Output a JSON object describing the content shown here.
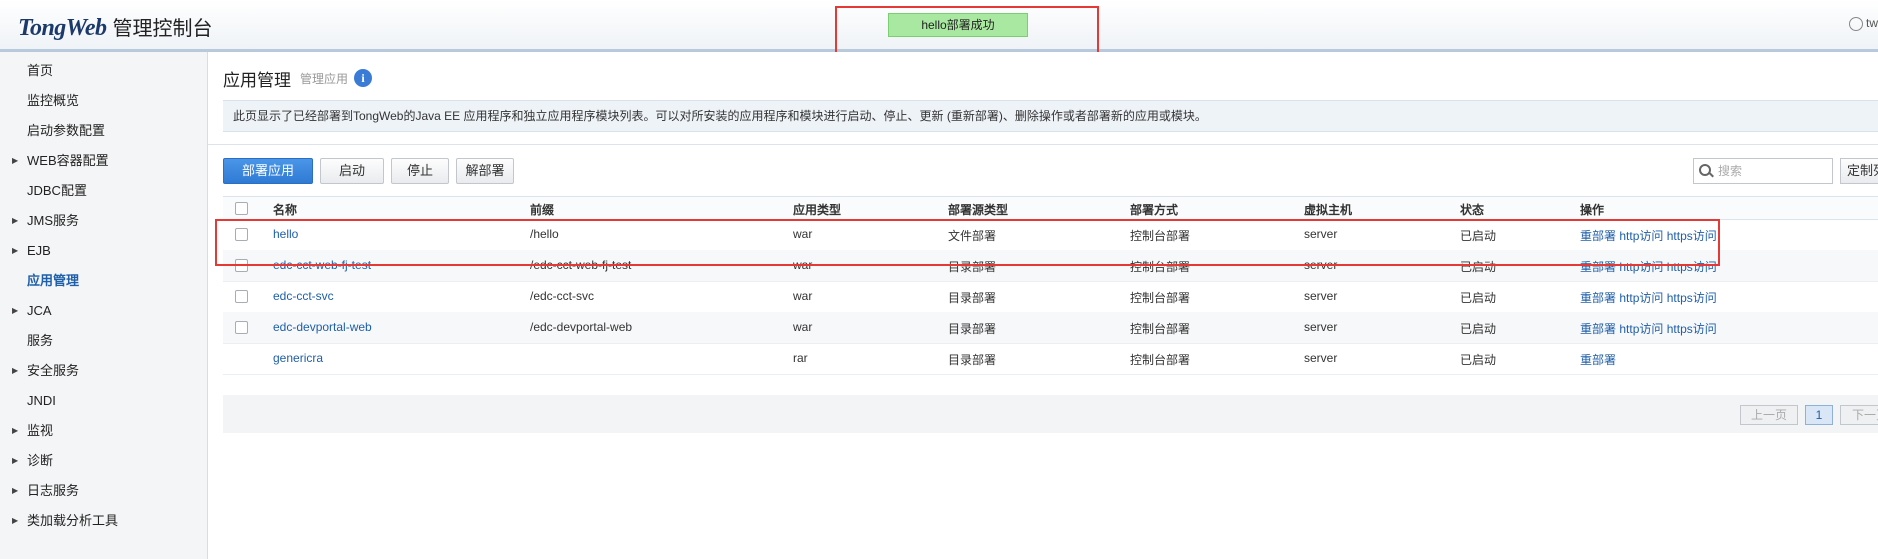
{
  "header": {
    "logo_brand": "TongWeb",
    "logo_subtitle": "管理控制台",
    "toast": "hello部署成功",
    "user": "tw"
  },
  "sidebar": {
    "items": [
      {
        "label": "首页",
        "has_arrow": false,
        "active": false
      },
      {
        "label": "监控概览",
        "has_arrow": false,
        "active": false
      },
      {
        "label": "启动参数配置",
        "has_arrow": false,
        "active": false
      },
      {
        "label": "WEB容器配置",
        "has_arrow": true,
        "active": false
      },
      {
        "label": "JDBC配置",
        "has_arrow": false,
        "active": false
      },
      {
        "label": "JMS服务",
        "has_arrow": true,
        "active": false
      },
      {
        "label": "EJB",
        "has_arrow": true,
        "active": false
      },
      {
        "label": "应用管理",
        "has_arrow": false,
        "active": true
      },
      {
        "label": "JCA",
        "has_arrow": true,
        "active": false
      },
      {
        "label": "服务",
        "has_arrow": false,
        "active": false
      },
      {
        "label": "安全服务",
        "has_arrow": true,
        "active": false
      },
      {
        "label": "JNDI",
        "has_arrow": false,
        "active": false
      },
      {
        "label": "监视",
        "has_arrow": true,
        "active": false
      },
      {
        "label": "诊断",
        "has_arrow": true,
        "active": false
      },
      {
        "label": "日志服务",
        "has_arrow": true,
        "active": false
      },
      {
        "label": "类加载分析工具",
        "has_arrow": true,
        "active": false
      }
    ]
  },
  "main": {
    "title": "应用管理",
    "subtitle": "管理应用",
    "info_icon": "i",
    "description": "此页显示了已经部署到TongWeb的Java EE 应用程序和独立应用程序模块列表。可以对所安装的应用程序和模块进行启动、停止、更新 (重新部署)、删除操作或者部署新的应用或模块。",
    "toolbar": {
      "deploy": "部署应用",
      "start": "启动",
      "stop": "停止",
      "undeploy": "解部署",
      "search_placeholder": "搜索",
      "customize": "定制列"
    },
    "table": {
      "headers": [
        "名称",
        "前缀",
        "应用类型",
        "部署源类型",
        "部署方式",
        "虚拟主机",
        "状态",
        "操作"
      ],
      "rows": [
        {
          "name": "hello",
          "prefix": "/hello",
          "type": "war",
          "source": "文件部署",
          "method": "控制台部署",
          "host": "server",
          "status": "已启动",
          "actions": [
            "重部署",
            "http访问",
            "https访问"
          ],
          "checkbox": true
        },
        {
          "name": "edc-cct-web-fj-test",
          "prefix": "/edc-cct-web-fj-test",
          "type": "war",
          "source": "目录部署",
          "method": "控制台部署",
          "host": "server",
          "status": "已启动",
          "actions": [
            "重部署",
            "http访问",
            "https访问"
          ],
          "checkbox": true
        },
        {
          "name": "edc-cct-svc",
          "prefix": "/edc-cct-svc",
          "type": "war",
          "source": "目录部署",
          "method": "控制台部署",
          "host": "server",
          "status": "已启动",
          "actions": [
            "重部署",
            "http访问",
            "https访问"
          ],
          "checkbox": true
        },
        {
          "name": "edc-devportal-web",
          "prefix": "/edc-devportal-web",
          "type": "war",
          "source": "目录部署",
          "method": "控制台部署",
          "host": "server",
          "status": "已启动",
          "actions": [
            "重部署",
            "http访问",
            "https访问"
          ],
          "checkbox": true
        },
        {
          "name": "genericra",
          "prefix": "",
          "type": "rar",
          "source": "目录部署",
          "method": "控制台部署",
          "host": "server",
          "status": "已启动",
          "actions": [
            "重部署"
          ],
          "checkbox": false
        }
      ]
    },
    "pager": {
      "prev": "上一页",
      "current": "1",
      "next": "下一页"
    }
  }
}
